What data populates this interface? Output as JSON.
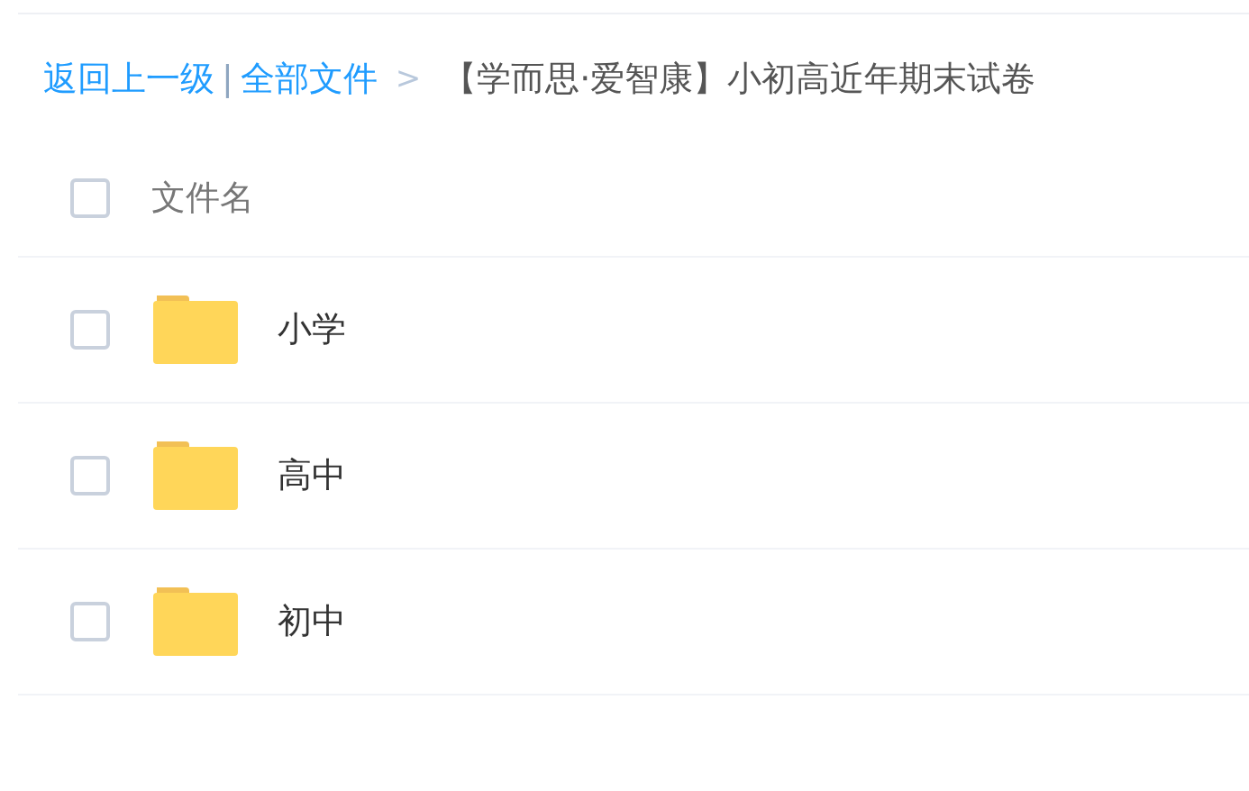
{
  "breadcrumb": {
    "back": "返回上一级",
    "divider": "|",
    "root": "全部文件",
    "arrow": ">",
    "current": "【学而思·爱智康】小初高近年期末试卷"
  },
  "header": {
    "checked": false,
    "label": "文件名"
  },
  "files": [
    {
      "name": "小学",
      "kind": "folder",
      "checked": false
    },
    {
      "name": "高中",
      "kind": "folder",
      "checked": false
    },
    {
      "name": "初中",
      "kind": "folder",
      "checked": false
    }
  ]
}
